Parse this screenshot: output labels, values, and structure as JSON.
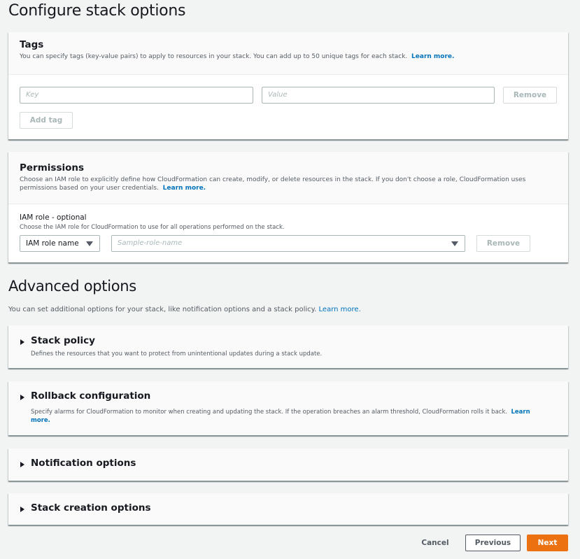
{
  "page": {
    "title": "Configure stack options"
  },
  "tags": {
    "title": "Tags",
    "description": "You can specify tags (key-value pairs) to apply to resources in your stack. You can add up to 50 unique tags for each stack.",
    "learn_more": "Learn more.",
    "key_placeholder": "Key",
    "value_placeholder": "Value",
    "remove_label": "Remove",
    "add_tag_label": "Add tag"
  },
  "permissions": {
    "title": "Permissions",
    "description": "Choose an IAM role to explicitly define how CloudFormation can create, modify, or delete resources in the stack. If you don't choose a role, CloudFormation uses permissions based on your user credentials.",
    "learn_more": "Learn more.",
    "iam_role_label": "IAM role - optional",
    "iam_role_desc": "Choose the IAM role for CloudFormation to use for all operations performed on the stack.",
    "role_type_selected": "IAM role name",
    "role_name_placeholder": "Sample-role-name",
    "remove_label": "Remove"
  },
  "advanced": {
    "title": "Advanced options",
    "description": "You can set additional options for your stack, like notification options and a stack policy.",
    "learn_more": "Learn more.",
    "sections": [
      {
        "title": "Stack policy",
        "description": "Defines the resources that you want to protect from unintentional updates during a stack update."
      },
      {
        "title": "Rollback configuration",
        "description": "Specify alarms for CloudFormation to monitor when creating and updating the stack. If the operation breaches an alarm threshold, CloudFormation rolls it back.",
        "learn_more": "Learn more."
      },
      {
        "title": "Notification options"
      },
      {
        "title": "Stack creation options"
      }
    ]
  },
  "footer": {
    "cancel_label": "Cancel",
    "previous_label": "Previous",
    "next_label": "Next"
  },
  "colors": {
    "primary_button": "#ec7211",
    "link": "#0073bb",
    "background": "#f2f3f3"
  }
}
